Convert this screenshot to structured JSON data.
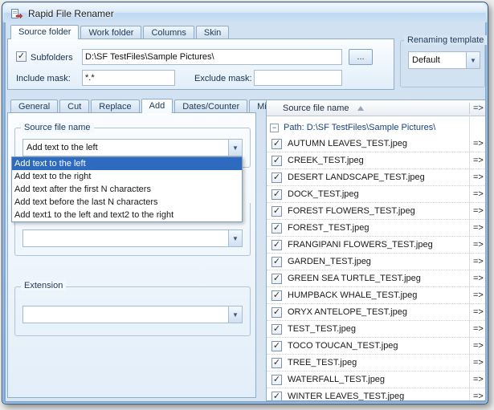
{
  "window": {
    "title": "Rapid File Renamer"
  },
  "colors": {
    "selection_highlight": "#2e6bc0",
    "path_group_text": "#17427d",
    "frame_blue": "#86afd7",
    "panel_border": "#8fadc9"
  },
  "top_tabs": [
    {
      "label": "Source folder",
      "active": true
    },
    {
      "label": "Work folder",
      "active": false
    },
    {
      "label": "Columns",
      "active": false
    },
    {
      "label": "Skin",
      "active": false
    }
  ],
  "source_panel": {
    "subfolders_label": "Subfolders",
    "subfolders_checked": true,
    "path_value": "D:\\SF TestFiles\\Sample Pictures\\",
    "browse_label": "...",
    "include_mask_label": "Include mask:",
    "include_mask_value": "*.*",
    "exclude_mask_label": "Exclude mask:",
    "exclude_mask_value": ""
  },
  "renaming_template": {
    "caption": "Renaming template",
    "value": "Default"
  },
  "lower_tabs": [
    {
      "label": "General",
      "active": false
    },
    {
      "label": "Cut",
      "active": false
    },
    {
      "label": "Replace",
      "active": false
    },
    {
      "label": "Add",
      "active": true
    },
    {
      "label": "Dates/Counter",
      "active": false
    },
    {
      "label": "Misc",
      "active": false
    }
  ],
  "add_tab": {
    "source_group_caption": "Source file name",
    "combo_value": "Add text to the left",
    "selected_option": "Add text to the left",
    "dropdown_options": [
      "Add text to the left",
      "Add text to the right",
      "Add text after the first N characters",
      "Add text before the last N characters",
      "Add text1 to the left and text2 to the right"
    ],
    "second_combo_value": "",
    "extension_group_caption": "Extension",
    "extension_combo_value": ""
  },
  "file_list": {
    "header": {
      "name_column": "Source file name",
      "arrow_column": "=>"
    },
    "path_group_label": "Path: D:\\SF TestFiles\\Sample Pictures\\",
    "rows": [
      {
        "name": "AUTUMN LEAVES_TEST.jpeg",
        "checked": true,
        "arrow": "=>"
      },
      {
        "name": "CREEK_TEST.jpeg",
        "checked": true,
        "arrow": "=>"
      },
      {
        "name": "DESERT LANDSCAPE_TEST.jpeg",
        "checked": true,
        "arrow": "=>"
      },
      {
        "name": "DOCK_TEST.jpeg",
        "checked": true,
        "arrow": "=>"
      },
      {
        "name": "FOREST FLOWERS_TEST.jpeg",
        "checked": true,
        "arrow": "=>"
      },
      {
        "name": "FOREST_TEST.jpeg",
        "checked": true,
        "arrow": "=>"
      },
      {
        "name": "FRANGIPANI FLOWERS_TEST.jpeg",
        "checked": true,
        "arrow": "=>"
      },
      {
        "name": "GARDEN_TEST.jpeg",
        "checked": true,
        "arrow": "=>"
      },
      {
        "name": "GREEN SEA TURTLE_TEST.jpeg",
        "checked": true,
        "arrow": "=>"
      },
      {
        "name": "HUMPBACK WHALE_TEST.jpeg",
        "checked": true,
        "arrow": "=>"
      },
      {
        "name": "ORYX ANTELOPE_TEST.jpeg",
        "checked": true,
        "arrow": "=>"
      },
      {
        "name": "TEST_TEST.jpeg",
        "checked": true,
        "arrow": "=>"
      },
      {
        "name": "TOCO TOUCAN_TEST.jpeg",
        "checked": true,
        "arrow": "=>"
      },
      {
        "name": "TREE_TEST.jpeg",
        "checked": true,
        "arrow": "=>"
      },
      {
        "name": "WATERFALL_TEST.jpeg",
        "checked": true,
        "arrow": "=>"
      },
      {
        "name": "WINTER LEAVES_TEST.jpeg",
        "checked": true,
        "arrow": "=>"
      }
    ]
  }
}
